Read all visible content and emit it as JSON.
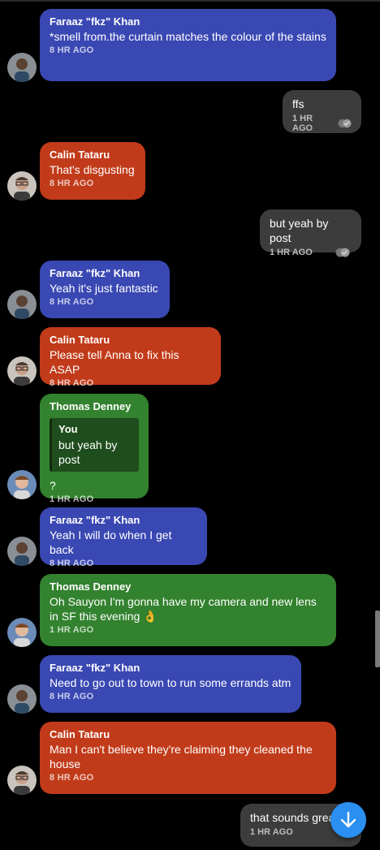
{
  "messages": [
    {
      "sender": "Faraaz \"fkz\" Khan",
      "text": "*smell from.the curtain matches the colour of the stains",
      "time": "8 HR AGO"
    },
    {
      "text": "ffs",
      "time": "1 HR AGO"
    },
    {
      "sender": "Calin Tataru",
      "text": "That's disgusting",
      "time": "8 HR AGO"
    },
    {
      "text": "but yeah by post",
      "time": "1 HR AGO"
    },
    {
      "sender": "Faraaz \"fkz\" Khan",
      "text": "Yeah it's just fantastic",
      "time": "8 HR AGO"
    },
    {
      "sender": "Calin Tataru",
      "text": "Please tell Anna to fix this ASAP",
      "time": "8 HR AGO"
    },
    {
      "sender": "Thomas Denney",
      "quote_sender": "You",
      "quote_text": "but yeah by post",
      "text": "?",
      "time": "1 HR AGO"
    },
    {
      "sender": "Faraaz \"fkz\" Khan",
      "text": "Yeah I will do when I get back",
      "time": "8 HR AGO"
    },
    {
      "sender": "Thomas Denney",
      "text": "Oh Sauyon I'm gonna have my camera and new lens in SF this evening 👌",
      "time": "1 HR AGO"
    },
    {
      "sender": "Faraaz \"fkz\" Khan",
      "text": "Need to go out to town to run some errands atm",
      "time": "8 HR AGO"
    },
    {
      "sender": "Calin Tataru",
      "text": "Man I can't believe they're claiming they cleaned the house",
      "time": "8 HR AGO"
    },
    {
      "text": "that sounds great",
      "time": "1 HR AGO"
    }
  ],
  "colors": {
    "faraaz": "#3a48b3",
    "calin": "#c13b1a",
    "thomas": "#33822f",
    "outgoing": "#3c3c3c",
    "accent": "#2a8ff0"
  },
  "icons": {
    "read": "double-check-icon",
    "scroll": "arrow-down-icon"
  }
}
